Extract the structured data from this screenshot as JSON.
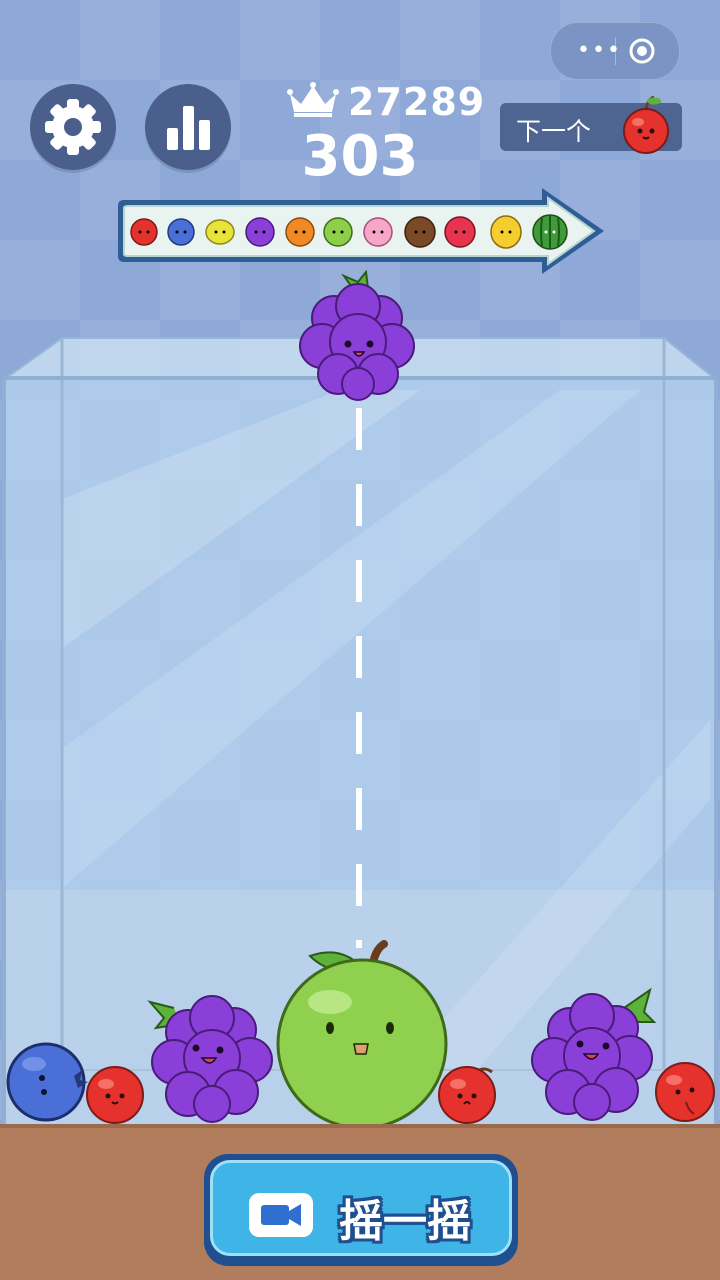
{
  "hud": {
    "best_score": "27289",
    "current_score": "303",
    "next_label": "下一个",
    "next_fruit": "cherry"
  },
  "buttons": {
    "settings_icon": "gear-icon",
    "leaderboard_icon": "bar-chart-icon",
    "shake_label": "摇一摇",
    "shake_icon": "video-camera-icon"
  },
  "capsule": {
    "more_icon": "more-dots-icon",
    "close_icon": "target-icon"
  },
  "evolution_chain": [
    "cherry",
    "blueberry",
    "lemon",
    "grape",
    "orange",
    "green-apple",
    "peach",
    "coconut",
    "dragon-fruit",
    "pineapple",
    "watermelon"
  ],
  "held_fruit": "grape",
  "tank_fruits": [
    "blueberry",
    "cherry",
    "grape",
    "green-apple",
    "cherry",
    "grape",
    "cherry"
  ],
  "colors": {
    "background": "#8ea8d7",
    "floor": "#b27d5c",
    "button_dark": "#4a5f8c",
    "shake_button": "#3fb4e6"
  }
}
